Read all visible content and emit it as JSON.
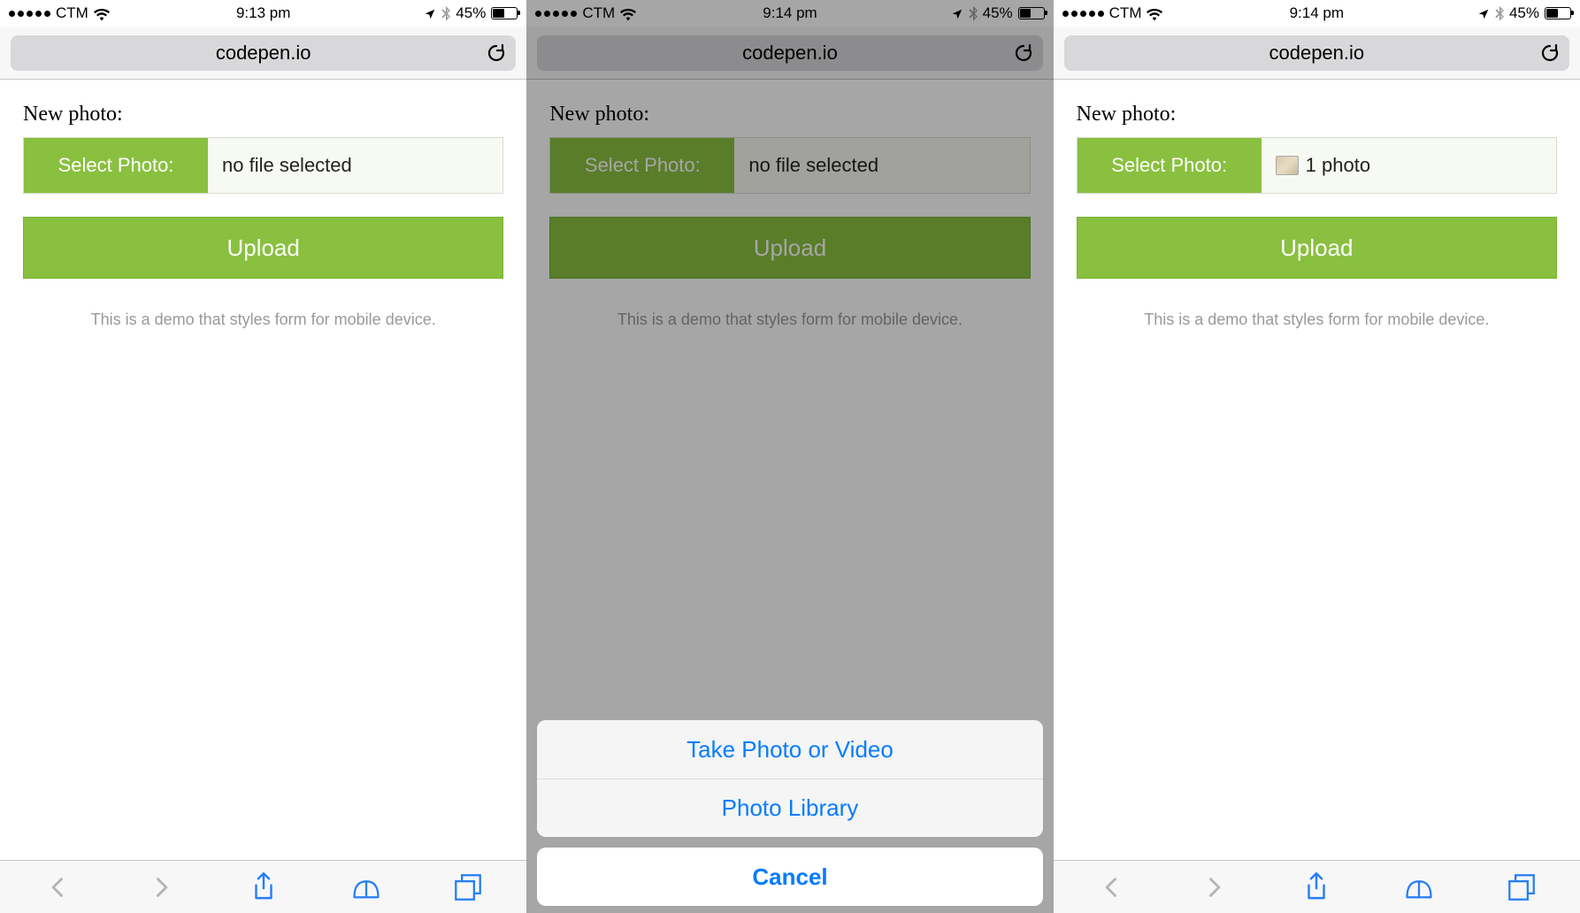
{
  "status": {
    "carrier": "CTM",
    "battery_percent": "45%"
  },
  "addr": {
    "url": "codepen.io"
  },
  "page": {
    "label": "New photo:",
    "select_button": "Select Photo:",
    "upload": "Upload",
    "demo_text": "This is a demo that styles form for mobile device."
  },
  "screens": [
    {
      "time": "9:13 pm",
      "file_text": "no file selected",
      "show_thumb": false,
      "actionsheet": false,
      "toolbar": true,
      "dimmed": false
    },
    {
      "time": "9:14 pm",
      "file_text": "no file selected",
      "show_thumb": false,
      "actionsheet": true,
      "toolbar": false,
      "dimmed": true
    },
    {
      "time": "9:14 pm",
      "file_text": "1 photo",
      "show_thumb": true,
      "actionsheet": false,
      "toolbar": true,
      "dimmed": false
    }
  ],
  "actionsheet": {
    "opt1": "Take Photo or Video",
    "opt2": "Photo Library",
    "cancel": "Cancel"
  }
}
